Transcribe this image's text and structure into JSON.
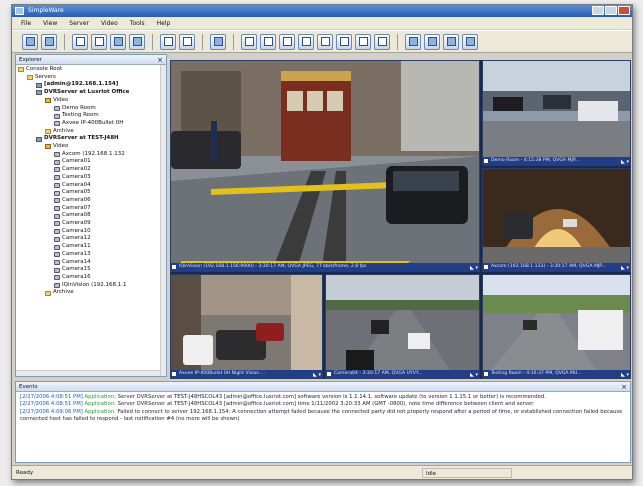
{
  "window": {
    "title": "SimpleWare"
  },
  "menu": [
    "File",
    "View",
    "Server",
    "Video",
    "Tools",
    "Help"
  ],
  "toolbar": {
    "buttons": [
      "open",
      "save",
      "grid-1",
      "grid-2",
      "grid-3",
      "snapshot",
      "fullscreen",
      "wrench",
      "user",
      "layout-1x1",
      "layout-2x2",
      "layout-3x3",
      "layout-4x4",
      "layout-1+5",
      "layout-1+7",
      "layout-2+8",
      "layout-custom",
      "monitor",
      "camera",
      "person",
      "window"
    ]
  },
  "explorer": {
    "title": "Explorer",
    "items": [
      {
        "label": "Console Root",
        "level": 0,
        "icon": "folder-icon",
        "bold": false
      },
      {
        "label": "Servers",
        "level": 1,
        "icon": "folder-icon",
        "bold": false
      },
      {
        "label": "[admin@192.168.1.154]",
        "level": 2,
        "icon": "server-icon",
        "bold": true
      },
      {
        "label": "DVRServer at Luxriot Office",
        "level": 2,
        "icon": "server-icon",
        "bold": true
      },
      {
        "label": "Video",
        "level": 3,
        "icon": "video-icon",
        "bold": false
      },
      {
        "label": "Demo Room",
        "level": 4,
        "icon": "camera-icon",
        "bold": false
      },
      {
        "label": "Testing Room",
        "level": 4,
        "icon": "camera-icon",
        "bold": false
      },
      {
        "label": "Axvee IP-400Bullet 0H",
        "level": 4,
        "icon": "camera-icon",
        "bold": false
      },
      {
        "label": "Archive",
        "level": 3,
        "icon": "folder-icon",
        "bold": false
      },
      {
        "label": "DVRServer at TEST-J48H",
        "level": 2,
        "icon": "server-icon",
        "bold": true
      },
      {
        "label": "Video",
        "level": 3,
        "icon": "video-icon",
        "bold": false
      },
      {
        "label": "Axcom (192.168.1.132",
        "level": 4,
        "icon": "camera-icon",
        "bold": false
      },
      {
        "label": "Camera01",
        "level": 4,
        "icon": "camera-icon",
        "bold": false
      },
      {
        "label": "Camera02",
        "level": 4,
        "icon": "camera-icon",
        "bold": false
      },
      {
        "label": "Camera03",
        "level": 4,
        "icon": "camera-icon",
        "bold": false
      },
      {
        "label": "Camera04",
        "level": 4,
        "icon": "camera-icon",
        "bold": false
      },
      {
        "label": "Camera05",
        "level": 4,
        "icon": "camera-icon",
        "bold": false
      },
      {
        "label": "Camera06",
        "level": 4,
        "icon": "camera-icon",
        "bold": false
      },
      {
        "label": "Camera07",
        "level": 4,
        "icon": "camera-icon",
        "bold": false
      },
      {
        "label": "Camera08",
        "level": 4,
        "icon": "camera-icon",
        "bold": false
      },
      {
        "label": "Camera09",
        "level": 4,
        "icon": "camera-icon",
        "bold": false
      },
      {
        "label": "Camera10",
        "level": 4,
        "icon": "camera-icon",
        "bold": false
      },
      {
        "label": "Camera12",
        "level": 4,
        "icon": "camera-icon",
        "bold": false
      },
      {
        "label": "Camera11",
        "level": 4,
        "icon": "camera-icon",
        "bold": false
      },
      {
        "label": "Camera13",
        "level": 4,
        "icon": "camera-icon",
        "bold": false
      },
      {
        "label": "Camera14",
        "level": 4,
        "icon": "camera-icon",
        "bold": false
      },
      {
        "label": "Camera15",
        "level": 4,
        "icon": "camera-icon",
        "bold": false
      },
      {
        "label": "Camera16",
        "level": 4,
        "icon": "camera-icon",
        "bold": false
      },
      {
        "label": "IQinVision (192.168.1.1",
        "level": 4,
        "icon": "camera-icon",
        "bold": false
      },
      {
        "label": "Archive",
        "level": 3,
        "icon": "folder-icon",
        "bold": false
      }
    ]
  },
  "tiles": [
    {
      "caption": "IQinVision (192.168.1.156:9000) - 3:30:17 AM, QVGA JPEG, 77 kb/s/frame, 2.8 fps",
      "scene": "cable-car"
    },
    {
      "caption": "Demo Room - 4:15:38 PM, QVGA MJP...",
      "scene": "parking"
    },
    {
      "caption": "Axcom (192.168.1.133) - 3:30:17 AM, QVGA MJP...",
      "scene": "tunnel"
    },
    {
      "caption": "Axvee IP-400Bullet 0H Night Vision ...",
      "scene": "street"
    },
    {
      "caption": "Camera04 - 3:30:17 AM, QVGA UYVY...",
      "scene": "highway"
    },
    {
      "caption": "Testing Room - 4:16:37 PM, QVGA MU...",
      "scene": "road"
    }
  ],
  "events": {
    "title": "Events",
    "entries": [
      {
        "ts": "[2/27/2006 4:08:51 PM]",
        "app": "Application:",
        "text": "Server DVRServer at TEST-J48HSCOL43 [admin@office.luxriot.com] software version is 1.1.14.1, software update (to version 1.1.15.1 or better) is recommended."
      },
      {
        "ts": "[2/27/2006 4:08:51 PM]",
        "app": "Application:",
        "text": "Server DVRServer at TEST-J48HSCOL43 [admin@office.luxriot.com] time 1/11/2002 3:20:33 AM (GMT -0800), note time difference between client and server"
      },
      {
        "ts": "[2/27/2006 4:09:06 PM]",
        "app": "Application:",
        "text": "Failed to connect to server 192.168.1.154: A connection attempt failed because the connected party did not properly respond after a period of time, or established connection failed because connected host has failed to respond - last notification #4 (no more will be shown)"
      }
    ]
  },
  "status": {
    "left": "Ready",
    "right": "Idle"
  }
}
